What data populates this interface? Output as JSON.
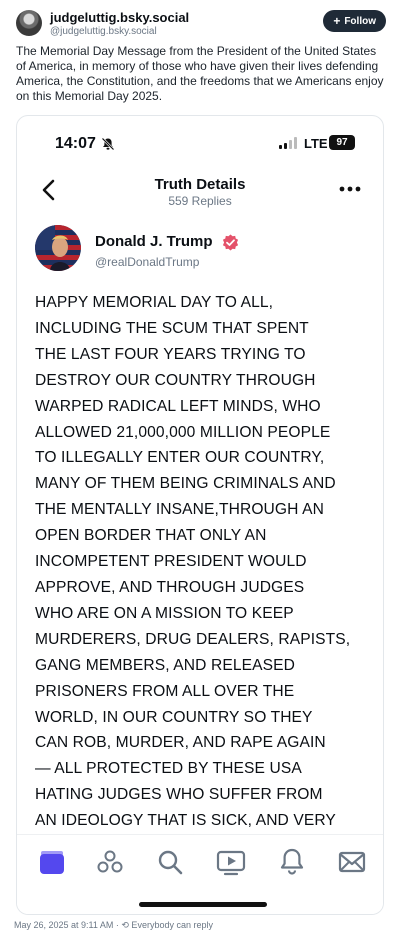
{
  "post": {
    "author_name": "judgeluttig.bsky.social",
    "author_handle": "@judgeluttig.bsky.social",
    "follow_label": "Follow",
    "text": "The Memorial Day Message from the President of the United States of America, in memory of those who have given their lives defending America, the Constitution, and the freedoms that we Americans enjoy on this Memorial Day 2025.",
    "footer": "May 26, 2025 at 9:11 AM · ⟲ Everybody can reply"
  },
  "screenshot": {
    "status": {
      "time": "14:07",
      "network": "LTE",
      "battery": "97"
    },
    "nav": {
      "title": "Truth Details",
      "subtitle": "559 Replies"
    },
    "truth": {
      "author_name": "Donald J. Trump",
      "author_handle": "@realDonaldTrump",
      "body": "HAPPY MEMORIAL DAY TO ALL,\nINCLUDING THE SCUM THAT SPENT\nTHE LAST FOUR YEARS TRYING TO\nDESTROY OUR COUNTRY THROUGH\nWARPED RADICAL LEFT MINDS, WHO\nALLOWED 21,000,000 MILLION PEOPLE\nTO ILLEGALLY ENTER OUR COUNTRY,\nMANY OF THEM BEING CRIMINALS AND\nTHE MENTALLY INSANE,THROUGH AN\nOPEN BORDER THAT ONLY AN\nINCOMPETENT PRESIDENT WOULD\nAPPROVE, AND THROUGH JUDGES\nWHO ARE ON A MISSION TO KEEP\nMURDERERS, DRUG DEALERS, RAPISTS,\nGANG MEMBERS, AND RELEASED\nPRISONERS FROM ALL OVER THE\nWORLD, IN OUR COUNTRY SO THEY\nCAN ROB, MURDER, AND RAPE AGAIN\n— ALL PROTECTED BY THESE USA\nHATING JUDGES WHO SUFFER FROM\nAN IDEOLOGY THAT IS SICK, AND VERY"
    },
    "tabs": [
      {
        "name": "home-icon"
      },
      {
        "name": "groups-icon"
      },
      {
        "name": "search-icon"
      },
      {
        "name": "video-icon"
      },
      {
        "name": "notifications-icon"
      },
      {
        "name": "messages-icon"
      }
    ]
  },
  "colors": {
    "accent": "#5448ee",
    "verified": "#e4526a",
    "follow_bg": "#1f2a37"
  }
}
